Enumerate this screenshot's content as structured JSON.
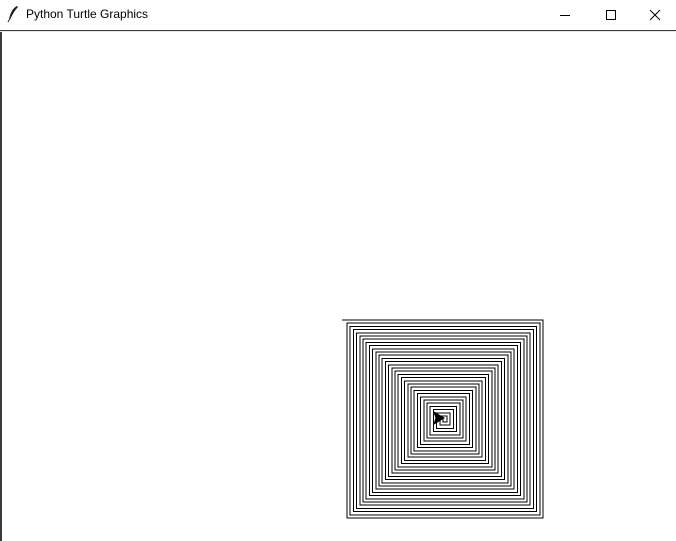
{
  "window": {
    "title": "Python Turtle Graphics",
    "icon": "feather-icon",
    "controls": {
      "minimize_icon": "minimize-icon",
      "maximize_icon": "maximize-icon",
      "close_icon": "close-icon"
    }
  },
  "canvas": {
    "background": "#ffffff",
    "pen_color": "#000000",
    "drawing": "square-spiral",
    "turtle_shape": "arrow"
  }
}
